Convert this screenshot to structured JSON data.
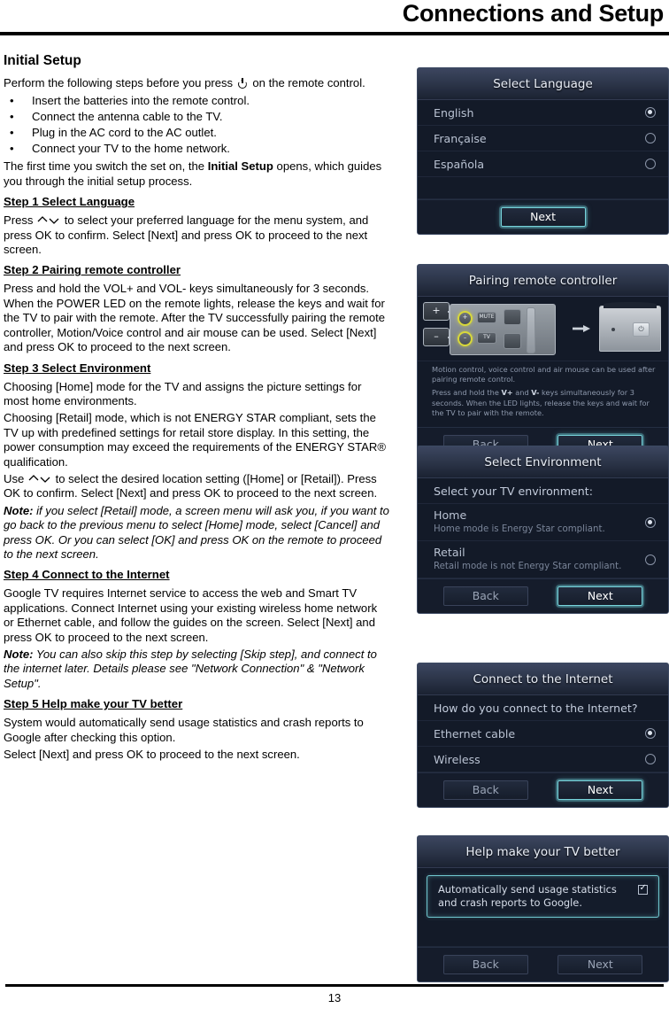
{
  "header": {
    "title": "Connections and Setup"
  },
  "footer": {
    "page_number": "13"
  },
  "document": {
    "section_title": "Initial Setup",
    "intro_p1_before": "Perform the following steps before you press",
    "intro_p1_after": "on the remote control.",
    "bullets": [
      "Insert the batteries into the remote control.",
      "Connect the antenna cable to the TV.",
      "Plug in the AC cord to the AC outlet.",
      "Connect your TV to the home network."
    ],
    "intro_p2_before": "The first time you switch the set on, the ",
    "intro_p2_bold": "Initial Setup",
    "intro_p2_after": " opens, which guides you through the initial setup process.",
    "steps": [
      {
        "heading": "Step 1 Select Language",
        "body_before": "Press",
        "body_after": "to select your preferred language for the menu system, and press OK to confirm. Select [Next] and press OK to proceed to the next screen."
      },
      {
        "heading": "Step 2 Pairing remote controller",
        "body": "Press and hold the VOL+ and VOL- keys simultaneously for 3 seconds. When the POWER LED on the remote lights, release the keys and wait for the TV to pair with the remote. After the TV successfully pairing the remote controller, Motion/Voice control and air mouse can be used. Select [Next] and press OK to proceed to the next screen."
      },
      {
        "heading": "Step 3 Select Environment",
        "body1": "Choosing [Home] mode for the TV and assigns the picture settings for most home environments.",
        "body2": "Choosing [Retail] mode, which is not ENERGY STAR compliant, sets the TV up with predefined settings for retail store display. In this setting, the power consumption may exceed the requirements of the ENERGY STAR® qualification.",
        "body3_before": "Use",
        "body3_after": "to select the desired location setting ([Home] or [Retail]). Press OK to confirm. Select [Next] and press OK to proceed to the next screen.",
        "note_label": "Note:",
        "note_text": " if you select [Retail] mode, a screen menu will ask you, if you want to go back to the previous menu to select [Home] mode, select [Cancel] and press OK. Or you can select [OK] and press OK on the remote to proceed to the next screen."
      },
      {
        "heading": "Step 4 Connect to the Internet",
        "body": "Google TV requires Internet service to access the web and Smart TV applications. Connect Internet using your existing wireless home network or Ethernet cable, and follow the guides on the screen. Select [Next] and press OK to proceed to the next screen.",
        "note_label": "Note:",
        "note_text": " You can also skip this step by selecting [Skip step], and connect to the internet later. Details please see \"Network Connection\" & \"Network Setup\"."
      },
      {
        "heading": "Step 5  Help make your TV better",
        "body1": "System would automatically send usage statistics and crash reports to Google after checking this option.",
        "body2": "Select [Next] and press OK to proceed to the next screen."
      }
    ]
  },
  "screens": {
    "select_language": {
      "title": "Select Language",
      "options": [
        {
          "label": "English",
          "selected": true
        },
        {
          "label": "Française",
          "selected": false
        },
        {
          "label": "Española",
          "selected": false
        }
      ],
      "next_label": "Next"
    },
    "pairing": {
      "title": "Pairing remote controller",
      "art": {
        "plus_callout": "+",
        "minus_callout": "–",
        "vol_up_symbol": "+",
        "vol_down_symbol": "–",
        "mute_label": "MUTE",
        "tv_label": "TV",
        "tv_power_symbol": "⏻"
      },
      "info_line1": "Motion control, voice control and air mouse can be used after pairing remote control.",
      "info_line2_part1": "Press and hold the ",
      "info_line2_key1": "V+",
      "info_line2_part2": " and ",
      "info_line2_key2": "V-",
      "info_line2_part3": " keys simultaneously for 3 seconds. When the LED lights, release the keys and wait for the TV to pair with the remote.",
      "back_label": "Back",
      "next_label": "Next"
    },
    "select_environment": {
      "title": "Select Environment",
      "prompt": "Select your TV environment:",
      "options": [
        {
          "label": "Home",
          "sub": "Home mode is Energy Star compliant.",
          "selected": true
        },
        {
          "label": "Retail",
          "sub": "Retail mode is not Energy Star compliant.",
          "selected": false
        }
      ],
      "back_label": "Back",
      "next_label": "Next"
    },
    "connect_internet": {
      "title": "Connect to the Internet",
      "prompt": "How do you connect to the Internet?",
      "options": [
        {
          "label": "Ethernet cable",
          "selected": true
        },
        {
          "label": "Wireless",
          "selected": false
        }
      ],
      "back_label": "Back",
      "next_label": "Next"
    },
    "help_make_better": {
      "title": "Help make your TV better",
      "checkbox_label": "Automatically send usage statistics and crash reports to Google.",
      "checked": true,
      "back_label": "Back",
      "next_label": "Next"
    }
  },
  "colors": {
    "panel_bg": "#131a28",
    "panel_header": "#2c3549",
    "accent_focus": "#6fc6ce",
    "text_primary": "#e3e9f3",
    "text_secondary": "#8e99ad"
  }
}
